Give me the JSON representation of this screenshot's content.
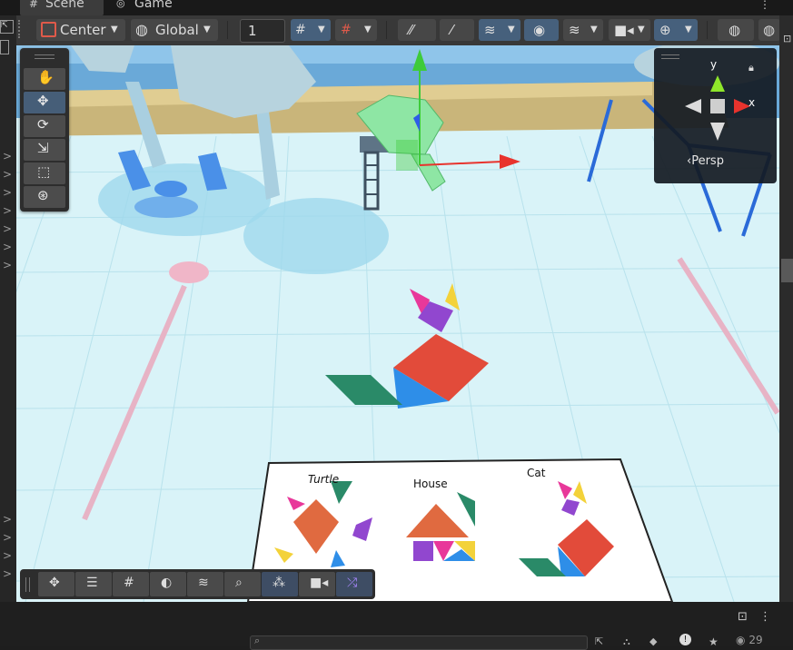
{
  "tabs": {
    "scene": "Scene",
    "game": "Game"
  },
  "toolbar": {
    "pivot_label": "Center",
    "space_label": "Global",
    "grid_snap_value": "1"
  },
  "gizmo": {
    "y_label": "y",
    "x_label": "x",
    "projection_label": "Persp"
  },
  "scene": {
    "signs": {
      "turtle": "Turtle",
      "house": "House",
      "cat": "Cat"
    }
  },
  "status": {
    "visibility_count": "29"
  },
  "icons": [
    "hand-icon",
    "move-icon",
    "rotate-icon",
    "scale-icon",
    "rect-icon",
    "transform-icon",
    "eye-icon",
    "layers-icon",
    "camera-icon",
    "gizmos-icon",
    "search-icon",
    "lock-icon",
    "more-icon"
  ],
  "colors": {
    "accent": "#46607c",
    "x_axis": "#e8332d",
    "y_axis": "#3ecb3a",
    "z_axis": "#2d5de8",
    "ground": "#d9f3f8"
  }
}
